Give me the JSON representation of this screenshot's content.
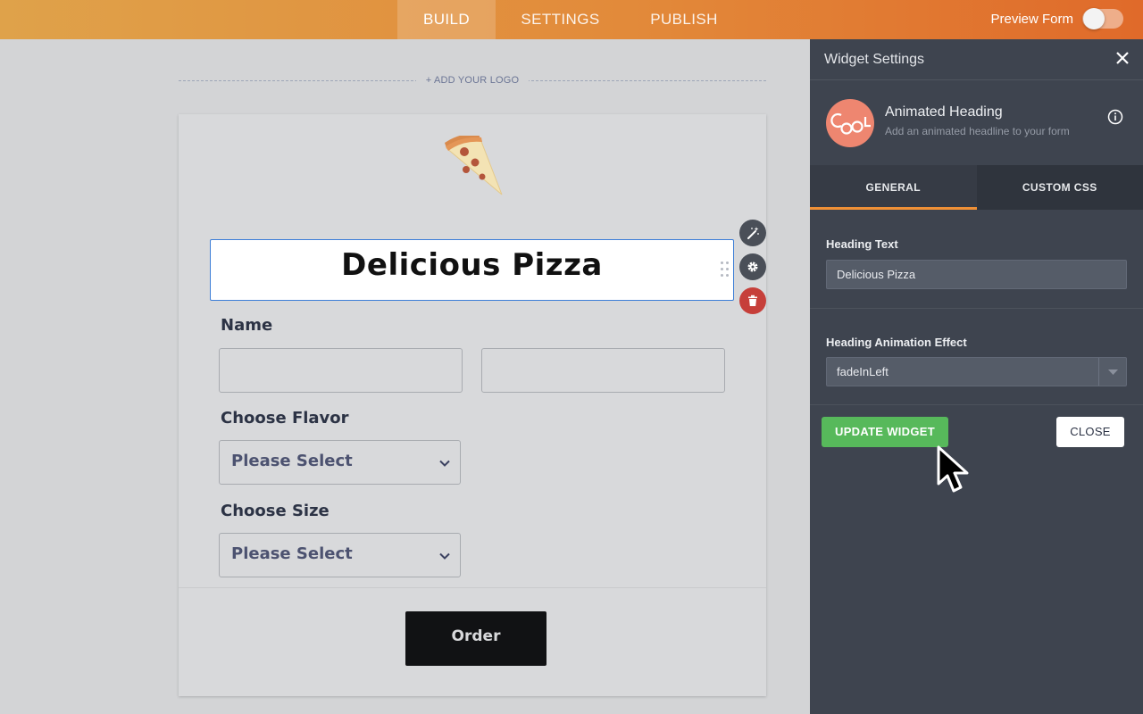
{
  "topbar": {
    "tabs": [
      {
        "label": "BUILD",
        "active": true
      },
      {
        "label": "SETTINGS",
        "active": false
      },
      {
        "label": "PUBLISH",
        "active": false
      }
    ],
    "preview_label": "Preview Form",
    "preview_on": false
  },
  "canvas": {
    "add_logo": "+ ADD YOUR LOGO",
    "heading": "Delicious Pizza",
    "name_label": "Name",
    "flavor_label": "Choose Flavor",
    "flavor_value": "Please Select",
    "size_label": "Choose Size",
    "size_value": "Please Select",
    "order_label": "Order",
    "tool_icons": [
      "magic-wand-icon",
      "gear-icon",
      "trash-icon"
    ]
  },
  "panel": {
    "title": "Widget Settings",
    "widget_name": "Animated Heading",
    "widget_desc": "Add an animated headline to your form",
    "tabs": [
      {
        "label": "GENERAL",
        "active": true
      },
      {
        "label": "CUSTOM CSS",
        "active": false
      }
    ],
    "heading_text_label": "Heading Text",
    "heading_text_value": "Delicious Pizza",
    "effect_label": "Heading Animation Effect",
    "effect_value": "fadeInLeft",
    "update_label": "UPDATE WIDGET",
    "close_label": "CLOSE"
  },
  "colors": {
    "accent_orange": "#ef9036",
    "update_green": "#57b95b",
    "panel_bg": "#3e444f",
    "delete_red": "#c63f3a",
    "selected_border": "#3d7ed7"
  }
}
